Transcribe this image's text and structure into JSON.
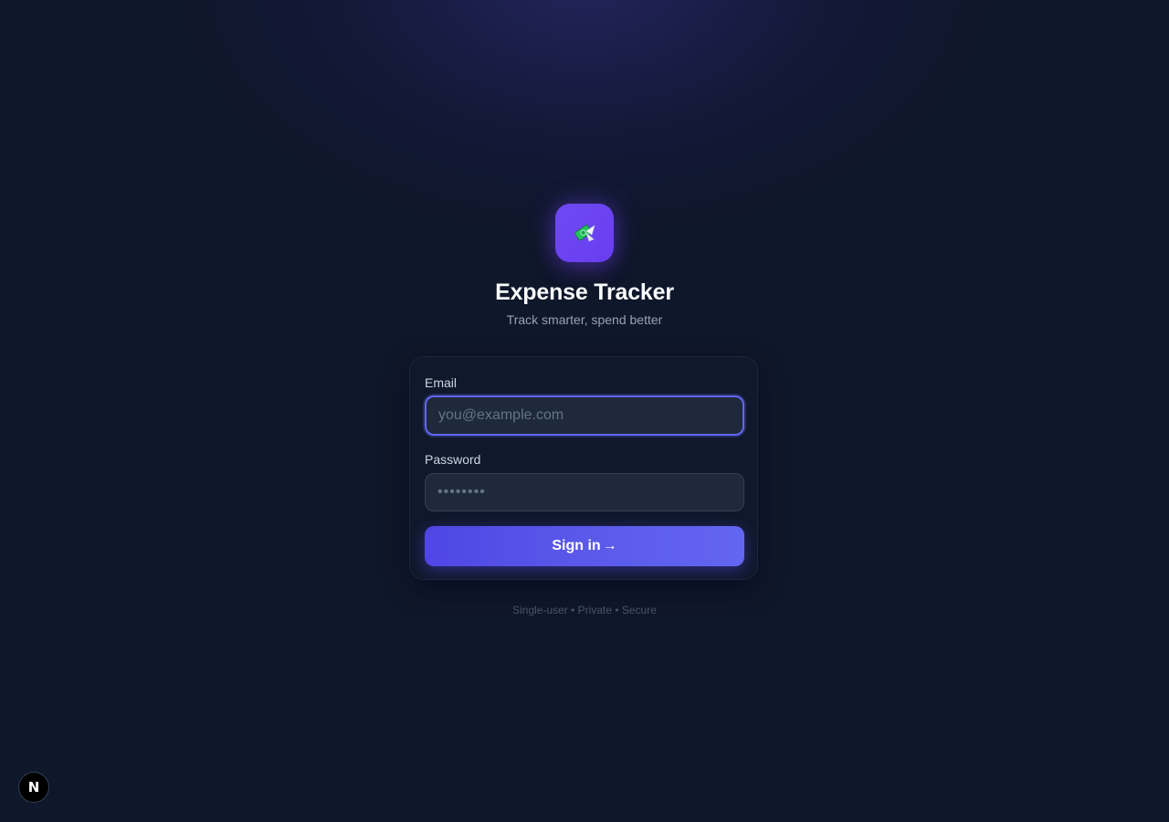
{
  "brand": {
    "icon": "money-with-wings-icon",
    "title": "Expense Tracker",
    "subtitle": "Track smarter, spend better"
  },
  "form": {
    "email_label": "Email",
    "email_placeholder": "you@example.com",
    "email_value": "",
    "password_label": "Password",
    "password_placeholder": "••••••••",
    "password_value": "",
    "submit_label": "Sign in",
    "submit_arrow": "→"
  },
  "footer": {
    "note": "Single-user • Private • Secure"
  },
  "dev_badge": {
    "label": "N",
    "icon": "nextjs-dev-icon"
  },
  "colors": {
    "background": "#0f172a",
    "accent": "#6366f1",
    "logo_tile": "#6d4af2",
    "card": "#111a2d",
    "input_bg": "#1e293b"
  }
}
